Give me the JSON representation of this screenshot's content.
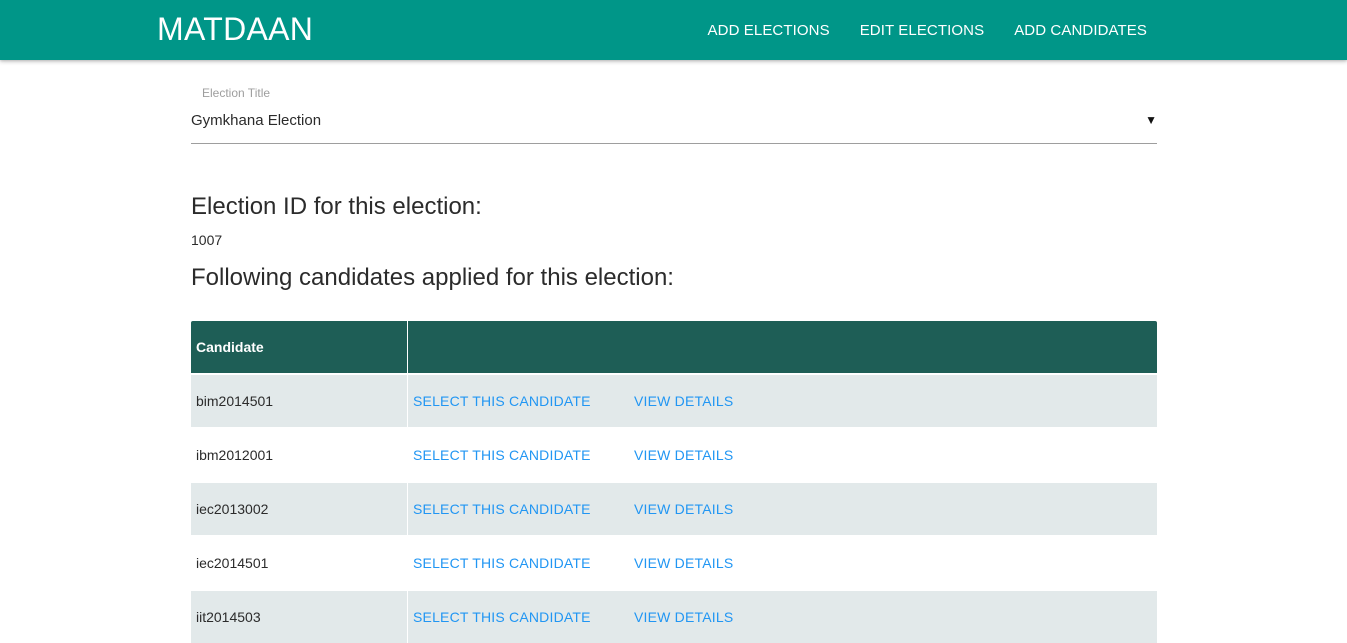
{
  "navbar": {
    "brand": "MATDAAN",
    "links": [
      "ADD ELECTIONS",
      "EDIT ELECTIONS",
      "ADD CANDIDATES"
    ]
  },
  "election_select": {
    "label": "Election Title",
    "value": "Gymkhana Election"
  },
  "election_id": {
    "heading": "Election ID for this election:",
    "value": "1007"
  },
  "candidates_heading": "Following candidates applied for this election:",
  "table": {
    "header": "Candidate",
    "select_label": "SELECT THIS CANDIDATE",
    "details_label": "VIEW DETAILS",
    "rows": [
      {
        "name": "bim2014501"
      },
      {
        "name": "ibm2012001"
      },
      {
        "name": "iec2013002"
      },
      {
        "name": "iec2014501"
      },
      {
        "name": "iit2014503"
      }
    ]
  },
  "colors": {
    "navbar": "#009688",
    "table_header": "#1e5e56",
    "row_shade": "#e2e9ea",
    "link": "#2196f3"
  }
}
